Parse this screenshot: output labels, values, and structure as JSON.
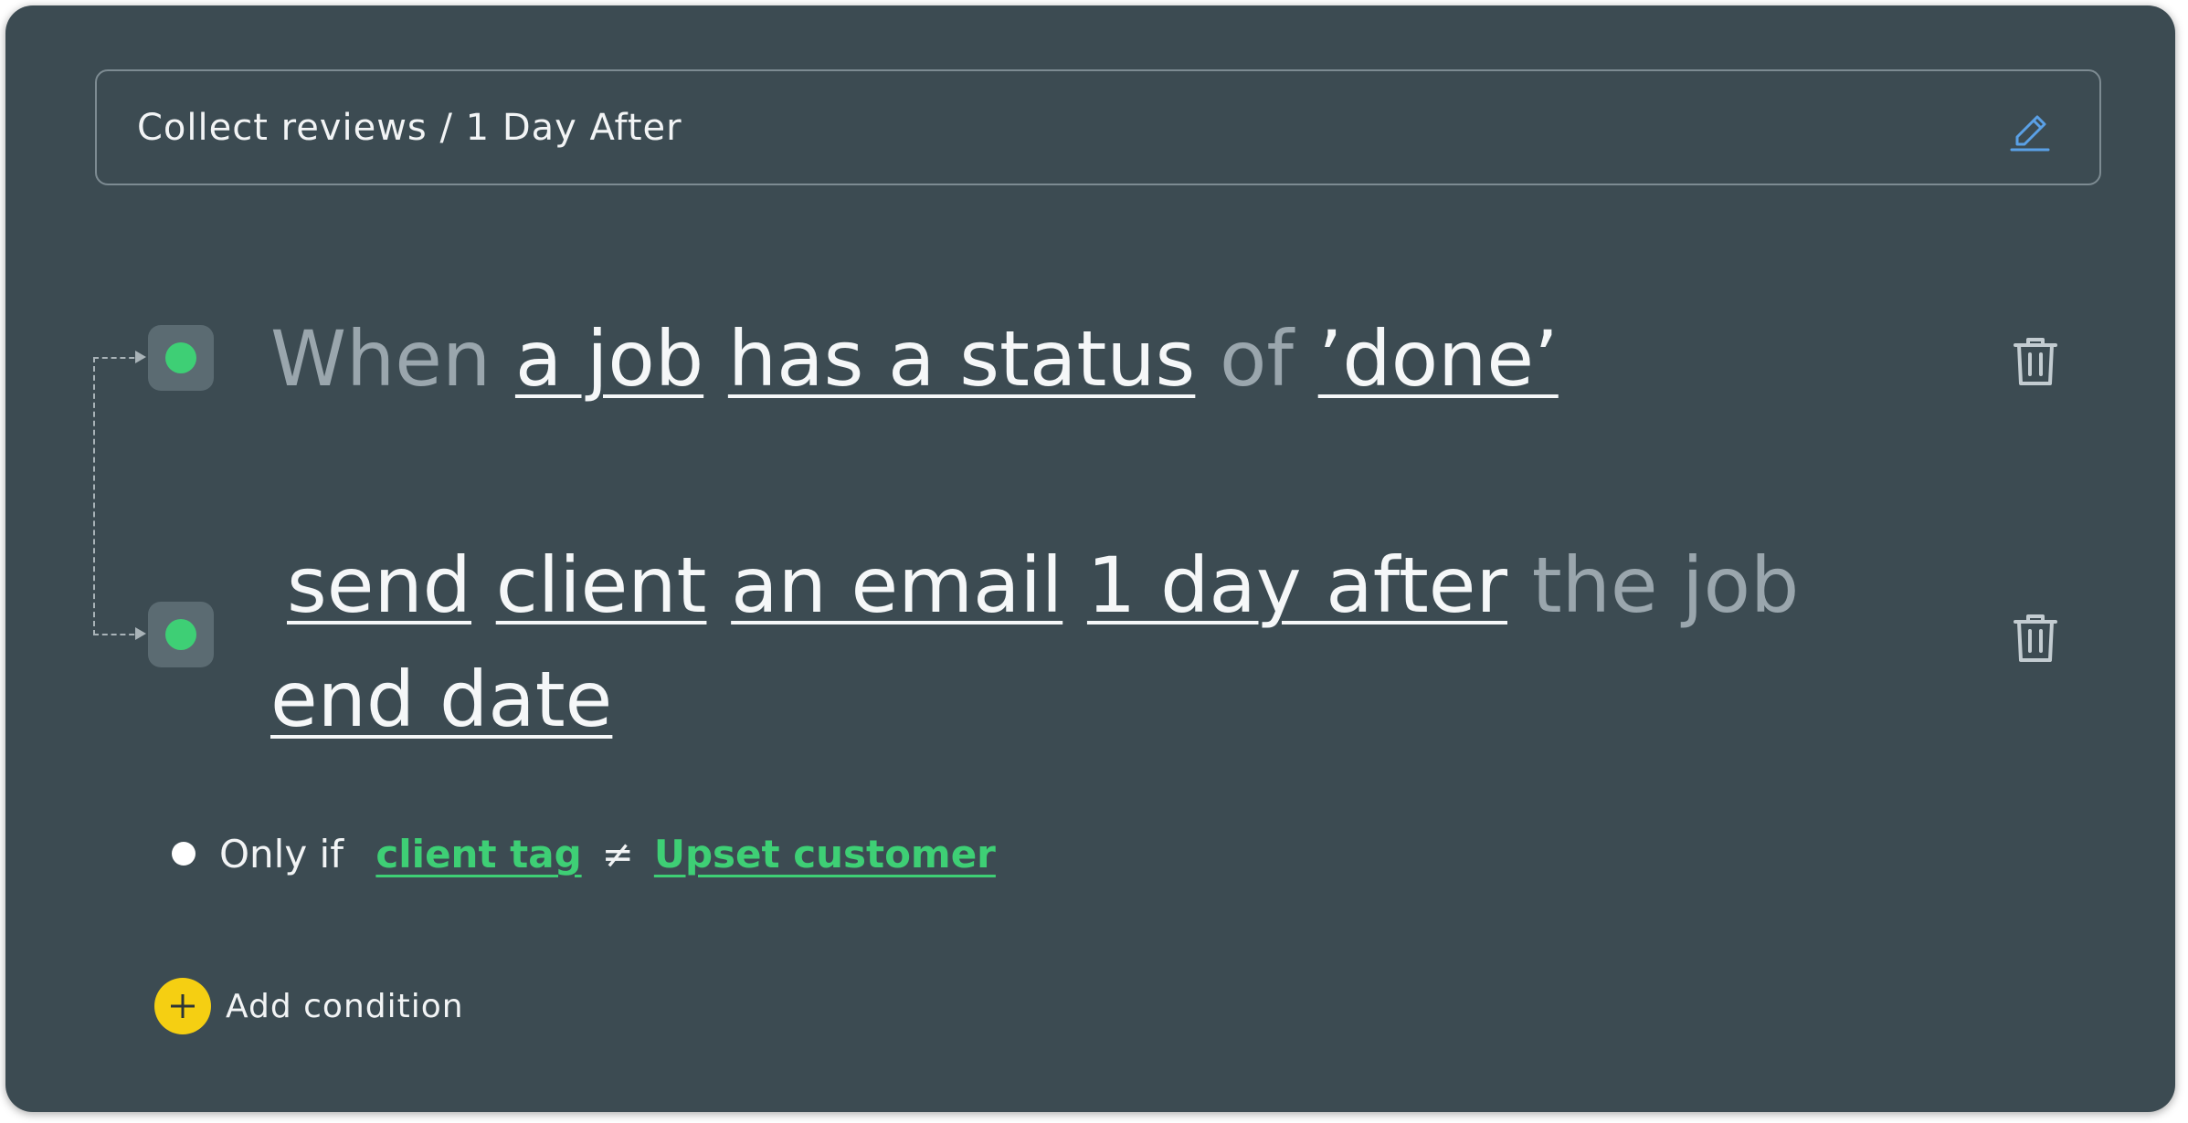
{
  "header": {
    "title": "Collect reviews / 1 Day After",
    "edit_icon": "pencil-icon"
  },
  "trigger": {
    "word_when": "When",
    "subject": "a job",
    "condition": "has a status",
    "word_of": "of",
    "value": "’done’",
    "delete_icon": "trash-icon"
  },
  "action": {
    "verb": "send",
    "recipient": "client",
    "channel": "an email",
    "timing": "1 day after",
    "word_the_job": "the job",
    "reference": "end date",
    "delete_icon": "trash-icon"
  },
  "filter": {
    "prefix": "Only if",
    "field": "client tag",
    "operator": "≠",
    "value": "Upset customer"
  },
  "add_condition": {
    "label": "Add condition",
    "icon": "plus-icon"
  },
  "colors": {
    "card_background": "#3c4b52",
    "status_green": "#3ecf75",
    "accent_blue": "#5aa0e6",
    "add_yellow": "#f5cf12"
  }
}
